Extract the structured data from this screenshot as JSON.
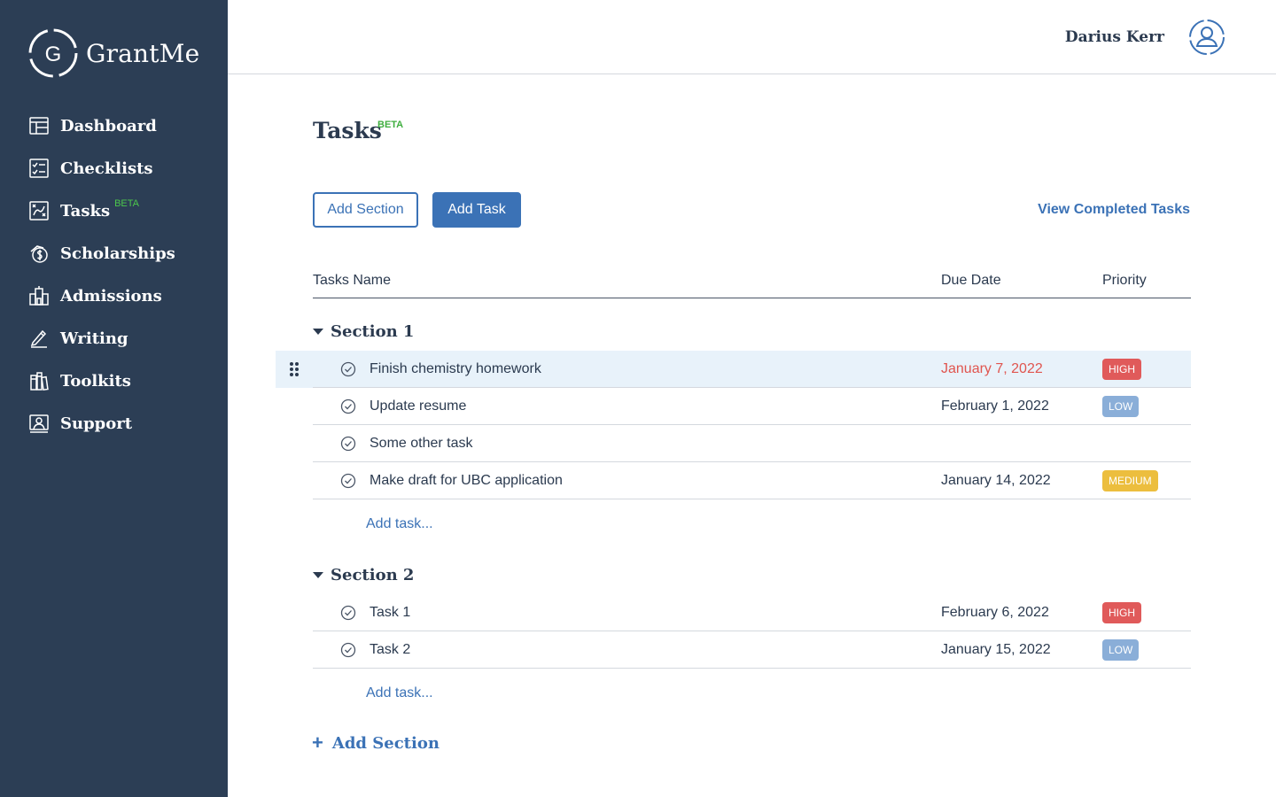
{
  "app": {
    "name": "GrantMe"
  },
  "sidebar": {
    "items": [
      {
        "label": "Dashboard",
        "icon": "dashboard-icon"
      },
      {
        "label": "Checklists",
        "icon": "checklist-icon"
      },
      {
        "label": "Tasks",
        "icon": "tasks-icon",
        "badge": "BETA"
      },
      {
        "label": "Scholarships",
        "icon": "scholarship-icon"
      },
      {
        "label": "Admissions",
        "icon": "admissions-icon"
      },
      {
        "label": "Writing",
        "icon": "pencil-icon"
      },
      {
        "label": "Toolkits",
        "icon": "toolkit-icon"
      },
      {
        "label": "Support",
        "icon": "support-icon"
      }
    ]
  },
  "header": {
    "user_name": "Darius Kerr"
  },
  "main": {
    "title": "Tasks",
    "title_badge": "BETA",
    "add_section_button": "Add Section",
    "add_task_button": "Add Task",
    "view_completed_link": "View Completed Tasks",
    "columns": {
      "name": "Tasks Name",
      "due": "Due Date",
      "priority": "Priority"
    },
    "sections": [
      {
        "title": "Section 1",
        "tasks": [
          {
            "name": "Finish chemistry homework",
            "due": "January 7, 2022",
            "priority": "HIGH"
          },
          {
            "name": "Update resume",
            "due": "February 1, 2022",
            "priority": "LOW"
          },
          {
            "name": "Some other task",
            "due": "",
            "priority": ""
          },
          {
            "name": "Make draft for UBC application",
            "due": "January 14, 2022",
            "priority": "MEDIUM"
          }
        ],
        "add_task_label": "Add task..."
      },
      {
        "title": "Section 2",
        "tasks": [
          {
            "name": "Task 1",
            "due": "February 6, 2022",
            "priority": "HIGH"
          },
          {
            "name": "Task 2",
            "due": "January 15, 2022",
            "priority": "LOW"
          }
        ],
        "add_task_label": "Add task..."
      }
    ],
    "add_section_bottom": "Add Section"
  },
  "colors": {
    "sidebar_bg": "#2c3e55",
    "accent": "#3b72b6",
    "high": "#e05a5a",
    "low": "#8aaed8",
    "medium": "#ecbe3e",
    "overdue": "#e0554f",
    "beta": "#3fae3f",
    "active_row": "#e8f2fa"
  }
}
